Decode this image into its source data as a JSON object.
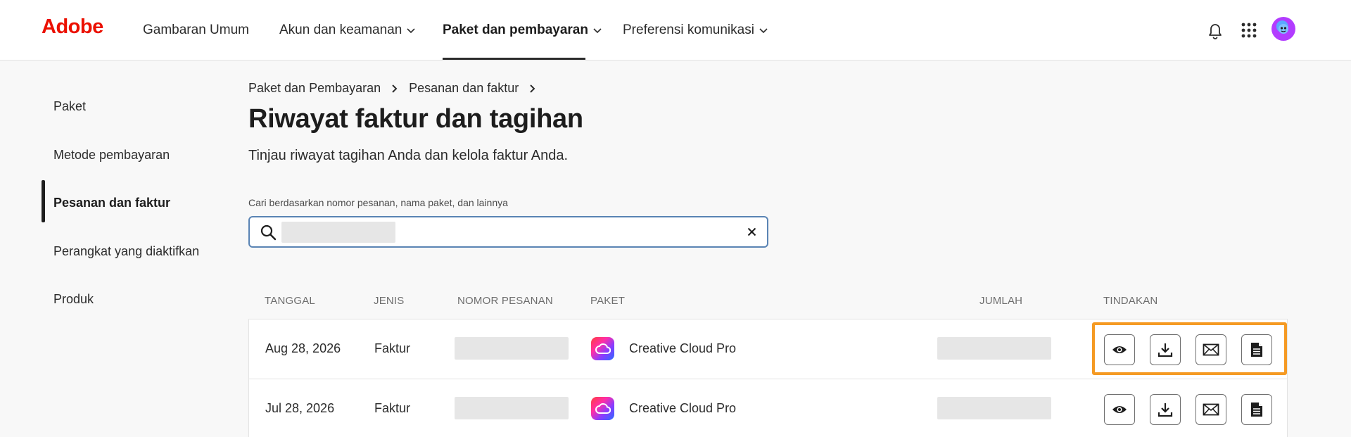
{
  "header": {
    "logo": "Adobe",
    "nav": [
      {
        "label": "Gambaran Umum"
      },
      {
        "label": "Akun dan keamanan"
      },
      {
        "label": "Paket dan pembayaran"
      },
      {
        "label": "Preferensi komunikasi"
      }
    ],
    "active_nav": "Paket dan pembayaran",
    "icons": [
      "bell-icon",
      "apps-grid-icon",
      "avatar"
    ]
  },
  "sidebar": {
    "items": [
      {
        "label": "Paket"
      },
      {
        "label": "Metode pembayaran"
      },
      {
        "label": "Pesanan dan faktur"
      },
      {
        "label": "Perangkat yang diaktifkan"
      },
      {
        "label": "Produk"
      }
    ],
    "active": "Pesanan dan faktur"
  },
  "breadcrumb": [
    "Paket dan Pembayaran",
    "Pesanan dan faktur"
  ],
  "page": {
    "title": "Riwayat faktur dan tagihan",
    "subtitle": "Tinjau riwayat tagihan Anda dan kelola faktur Anda."
  },
  "search": {
    "label": "Cari berdasarkan nomor pesanan, nama paket, dan lainnya",
    "value": ""
  },
  "table": {
    "columns": [
      "TANGGAL",
      "JENIS",
      "NOMOR PESANAN",
      "PAKET",
      "JUMLAH",
      "TINDAKAN"
    ],
    "rows": [
      {
        "date": "Aug 28, 2026",
        "type": "Faktur",
        "plan": "Creative Cloud Pro"
      },
      {
        "date": "Jul 28, 2026",
        "type": "Faktur",
        "plan": "Creative Cloud Pro"
      }
    ],
    "actions": [
      "eye-icon",
      "download-icon",
      "mail-icon",
      "document-icon"
    ]
  },
  "colors": {
    "brand": "#eb1000",
    "highlight": "#f59a23",
    "search_border": "#5a84b4"
  }
}
